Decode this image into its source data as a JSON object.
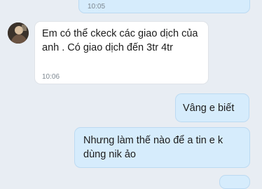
{
  "messages": [
    {
      "direction": "outgoing",
      "text": "",
      "time": "10:05"
    },
    {
      "direction": "incoming",
      "text": "Em có thể ckeck các giao dịch của anh . Có giao dịch đến 3tr 4tr",
      "time": "10:06"
    },
    {
      "direction": "outgoing",
      "text": "Vâng e biết"
    },
    {
      "direction": "outgoing",
      "text": "Nhưng làm thế nào để a tin e k dùng nik ảo"
    }
  ],
  "colors": {
    "background": "#e8edf3",
    "outgoing_bubble": "#d6ecfc",
    "incoming_bubble": "#ffffff"
  },
  "icons": {
    "avatar": "contact-avatar"
  }
}
